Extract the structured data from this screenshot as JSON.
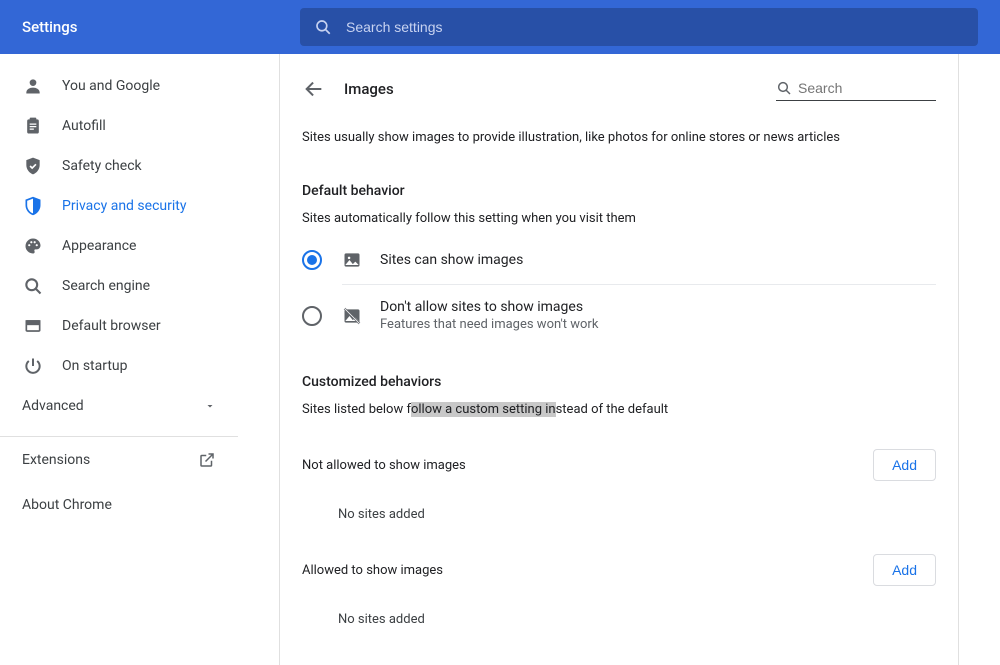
{
  "header": {
    "title": "Settings",
    "search_placeholder": "Search settings"
  },
  "sidebar": {
    "items": [
      {
        "label": "You and Google"
      },
      {
        "label": "Autofill"
      },
      {
        "label": "Safety check"
      },
      {
        "label": "Privacy and security"
      },
      {
        "label": "Appearance"
      },
      {
        "label": "Search engine"
      },
      {
        "label": "Default browser"
      },
      {
        "label": "On startup"
      }
    ],
    "advanced_label": "Advanced",
    "extensions_label": "Extensions",
    "about_label": "About Chrome"
  },
  "page": {
    "title": "Images",
    "search_placeholder": "Search",
    "description": "Sites usually show images to provide illustration, like photos for online stores or news articles",
    "default_behavior_title": "Default behavior",
    "default_behavior_sub": "Sites automatically follow this setting when you visit them",
    "option_allow_title": "Sites can show images",
    "option_block_title": "Don't allow sites to show images",
    "option_block_sub": "Features that need images won't work",
    "custom_title": "Customized behaviors",
    "custom_sub_pre": "Sites listed below f",
    "custom_sub_hl": "ollow a custom setting in",
    "custom_sub_post": "stead of the default",
    "not_allowed_title": "Not allowed to show images",
    "allowed_title": "Allowed to show images",
    "add_label": "Add",
    "empty_label": "No sites added"
  }
}
